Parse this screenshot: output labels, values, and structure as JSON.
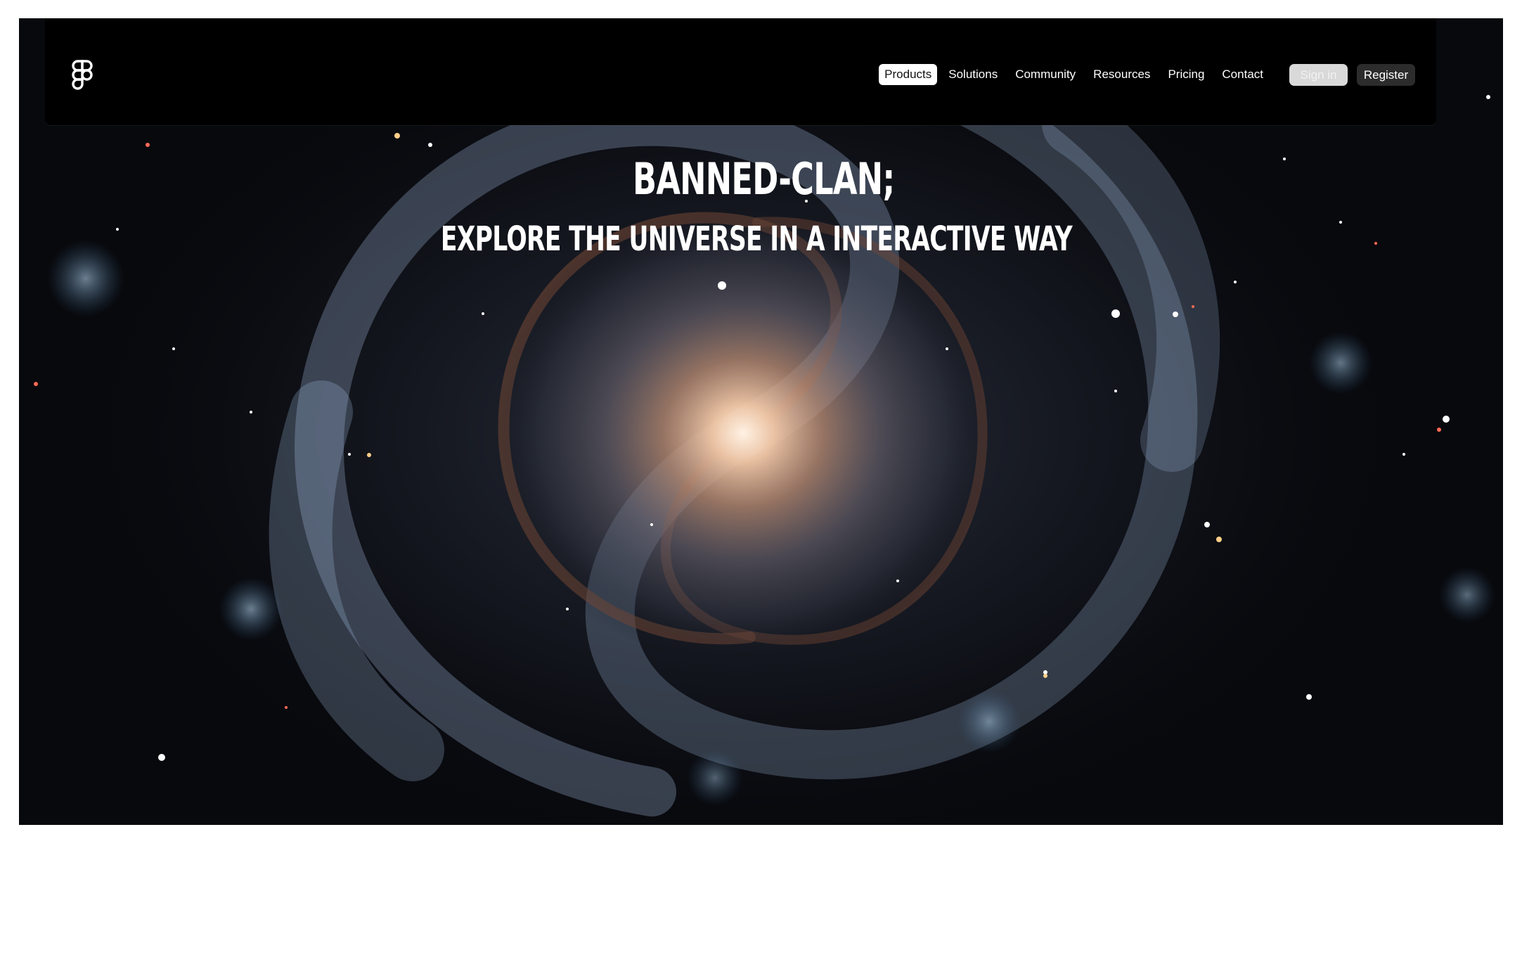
{
  "nav": {
    "logo_icon": "figma-logo-icon",
    "links": [
      {
        "label": "Products",
        "active": true
      },
      {
        "label": "Solutions",
        "active": false
      },
      {
        "label": "Community",
        "active": false
      },
      {
        "label": "Resources",
        "active": false
      },
      {
        "label": "Pricing",
        "active": false
      },
      {
        "label": "Contact",
        "active": false
      }
    ],
    "sign_in_label": "Sign in",
    "register_label": "Register"
  },
  "hero": {
    "title": "BANNED-CLAN;",
    "subtitle": "EXPLORE THE UNIVERSE IN A INTERACTIVE WAY",
    "background": "spiral-galaxy-image"
  },
  "colors": {
    "nav_background": "#000000",
    "active_link_bg": "#ffffff",
    "sign_in_bg": "#d9d9d9",
    "register_bg": "#2c2c2c",
    "page_background": "#ffffff"
  }
}
